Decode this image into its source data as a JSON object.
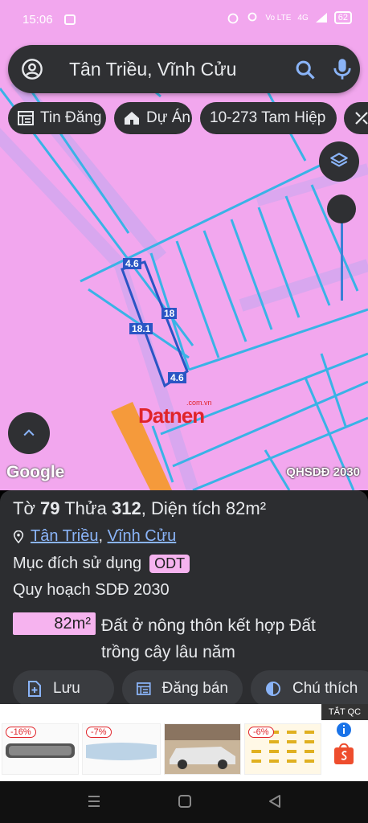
{
  "status": {
    "time": "15:06",
    "network": "Vo LTE",
    "signal": "4G",
    "battery": "62"
  },
  "search": {
    "query": "Tân Triều, Vĩnh Cửu"
  },
  "chips": [
    {
      "label": "Tin Đăng",
      "icon": "listing-icon"
    },
    {
      "label": "Dự Án",
      "icon": "house-icon"
    },
    {
      "label": "10-273 Tam Hiệp",
      "icon": ""
    },
    {
      "label": "",
      "icon": "ruler-icon"
    }
  ],
  "map": {
    "dimensions": {
      "top": "4.6",
      "right": "18",
      "left": "18.1",
      "bottom": "4.6"
    },
    "watermark": "Datnen",
    "watermark_domain": ".com.vn",
    "attribution": "Google",
    "layer_label": "QHSDĐ 2030",
    "colors": {
      "land": "#f2a7ee",
      "lines": "#39b3e6",
      "road": "#f59a3b",
      "highlight": "#2a55c4"
    }
  },
  "parcel": {
    "sheet_label": "Tờ",
    "sheet": "79",
    "plot_label": "Thửa",
    "plot": "312",
    "area_label": "Diện tích",
    "area": "82m²",
    "commune": "Tân Triều",
    "district": "Vĩnh Cửu",
    "purpose_label": "Mục đích sử dụng",
    "purpose_code": "ODT",
    "plan_label": "Quy hoạch SDĐ 2030",
    "plan_area": "82m²",
    "plan_desc": "Đất ở nông thôn kết hợp Đất trồng cây lâu năm"
  },
  "actions": [
    {
      "label": "Lưu",
      "icon": "add-doc-icon"
    },
    {
      "label": "Đăng bán",
      "icon": "calendar-icon"
    },
    {
      "label": "Chú thích",
      "icon": "half-circle-icon"
    }
  ],
  "ad": {
    "tag": "TẮT QC",
    "discounts": [
      "-16%",
      "-7%",
      "-6%"
    ]
  }
}
